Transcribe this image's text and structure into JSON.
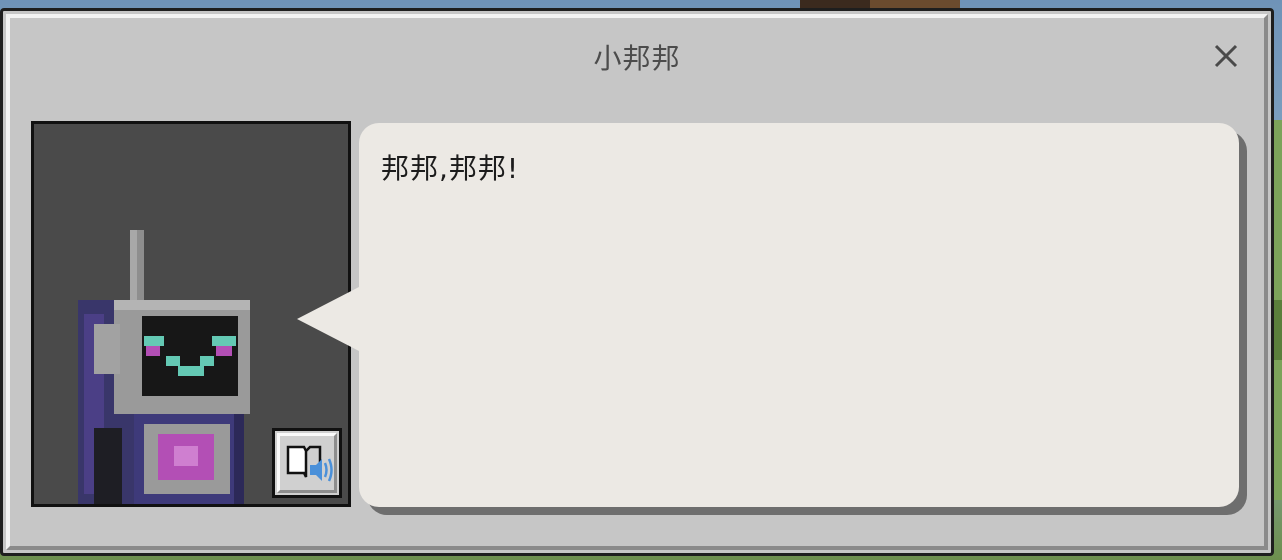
{
  "dialog": {
    "title": "小邦邦",
    "message": "邦邦,邦邦!",
    "close_icon": "close-icon",
    "read_aloud_icon": "book-speaker-icon"
  },
  "colors": {
    "panel": "#c6c6c6",
    "bubble": "#ece9e4",
    "portrait_bg": "#4a4a4a",
    "robot_face": "#64c9b4",
    "robot_chest": "#b34fb5"
  }
}
